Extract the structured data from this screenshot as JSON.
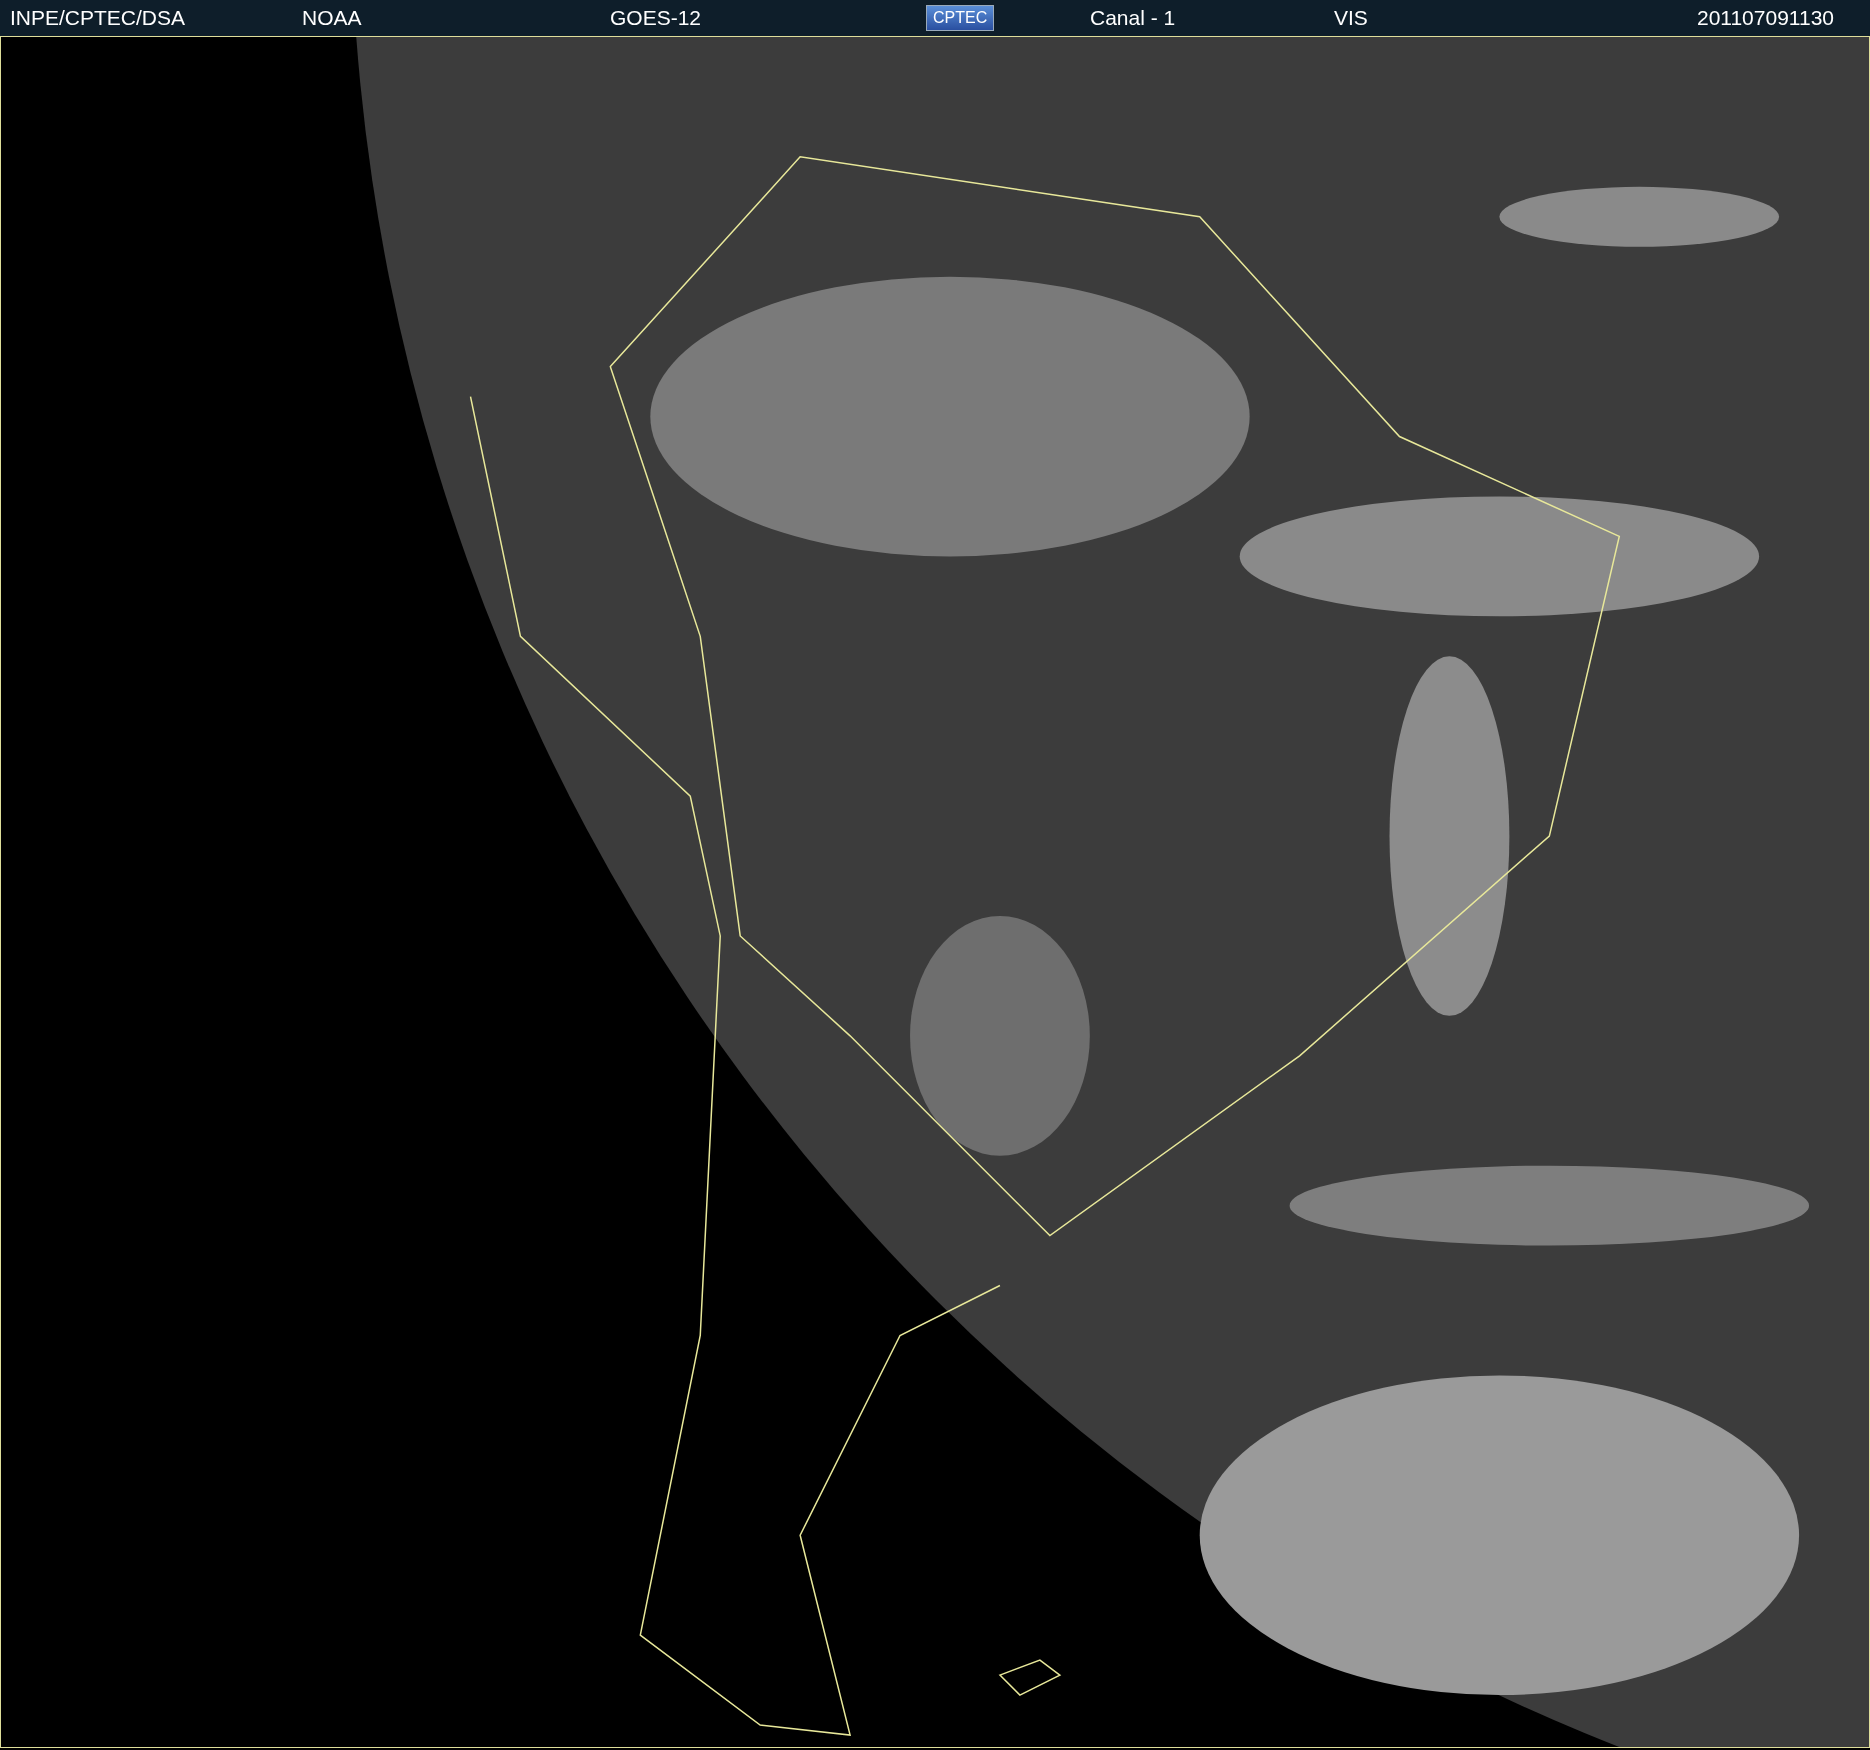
{
  "header": {
    "source": "INPE/CPTEC/DSA",
    "agency": "NOAA",
    "satellite": "GOES-12",
    "logo": "CPTEC",
    "channel": "Canal - 1",
    "band": "VIS",
    "timestamp": "201107091130"
  }
}
